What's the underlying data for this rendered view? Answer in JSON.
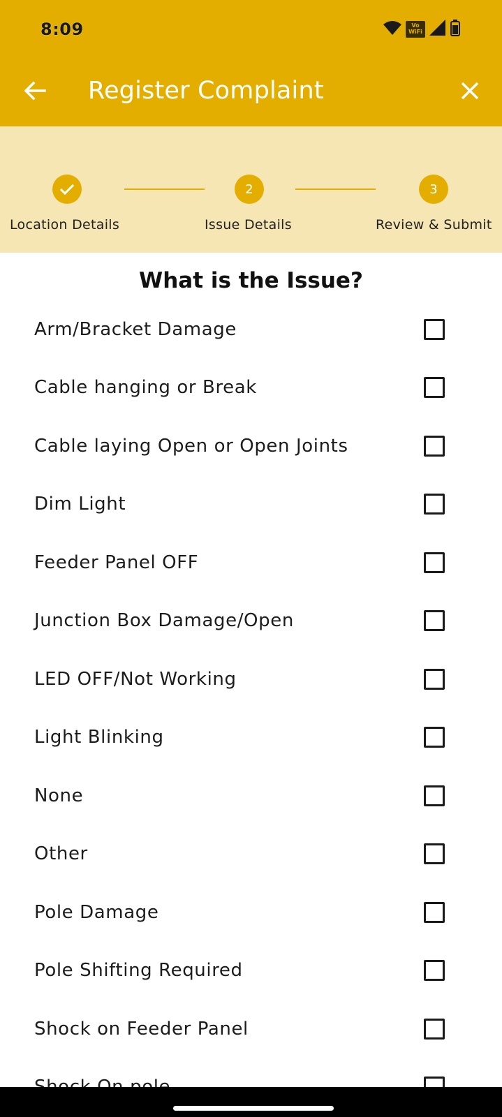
{
  "status_bar": {
    "time": "8:09",
    "vowifi_label": "Vo WiFi",
    "icons": [
      "wifi-icon",
      "vowifi-icon",
      "signal-icon",
      "battery-icon"
    ]
  },
  "app_bar": {
    "title": "Register Complaint",
    "back_icon": "arrow-left-icon",
    "close_icon": "close-icon",
    "background": "#e3ae00"
  },
  "stepper": {
    "background": "#f6e6b4",
    "accent": "#e3ae00",
    "steps": [
      {
        "label": "Location Details",
        "number": "",
        "state": "completed",
        "icon": "check-icon"
      },
      {
        "label": "Issue Details",
        "number": "2",
        "state": "active"
      },
      {
        "label": "Review & Submit",
        "number": "3",
        "state": "pending"
      }
    ]
  },
  "question": "What is the Issue?",
  "issues": [
    {
      "label": "Arm/Bracket Damage",
      "checked": false
    },
    {
      "label": "Cable hanging or Break",
      "checked": false
    },
    {
      "label": "Cable laying Open or Open Joints",
      "checked": false
    },
    {
      "label": "Dim Light",
      "checked": false
    },
    {
      "label": "Feeder Panel OFF",
      "checked": false
    },
    {
      "label": "Junction Box Damage/Open",
      "checked": false
    },
    {
      "label": "LED OFF/Not Working",
      "checked": false
    },
    {
      "label": "Light Blinking",
      "checked": false
    },
    {
      "label": "None",
      "checked": false
    },
    {
      "label": "Other",
      "checked": false
    },
    {
      "label": "Pole Damage",
      "checked": false
    },
    {
      "label": "Pole Shifting Required",
      "checked": false
    },
    {
      "label": "Shock on Feeder Panel",
      "checked": false
    },
    {
      "label": "Shock On pole",
      "checked": false
    }
  ]
}
